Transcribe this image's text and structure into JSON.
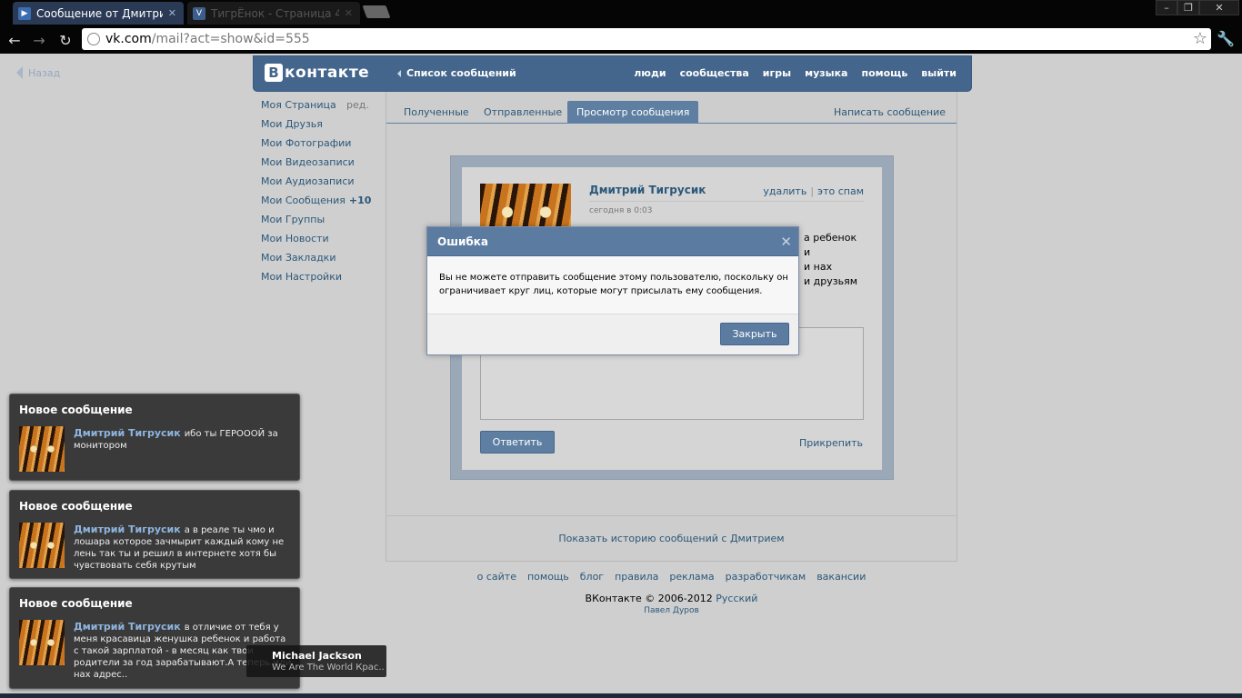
{
  "browser": {
    "tabs": [
      {
        "title": "Сообщение от Дмитрия Тг",
        "favicon": "play-icon",
        "active": true
      },
      {
        "title": "ТигрЁнок - Страница 4",
        "favicon": "vk-icon",
        "active": false
      }
    ],
    "url_domain": "vk.com",
    "url_path": "/mail?act=show&id=555"
  },
  "page": {
    "back_label": "Назад",
    "header": {
      "logo_letter": "B",
      "logo_text": "контакте",
      "messages_list": "Список сообщений",
      "nav": [
        "люди",
        "сообщества",
        "игры",
        "музыка",
        "помощь",
        "выйти"
      ]
    },
    "left_menu": {
      "edit_label": "ред.",
      "items": [
        {
          "label": "Моя Страница"
        },
        {
          "label": "Мои Друзья"
        },
        {
          "label": "Мои Фотографии"
        },
        {
          "label": "Мои Видеозаписи"
        },
        {
          "label": "Мои Аудиозаписи"
        },
        {
          "label": "Мои Сообщения",
          "count": "+10"
        },
        {
          "label": "Мои Группы"
        },
        {
          "label": "Мои Новости"
        },
        {
          "label": "Мои Закладки"
        },
        {
          "label": "Мои Настройки"
        }
      ]
    },
    "tabs": [
      "Полученные",
      "Отправленные",
      "Просмотр сообщения"
    ],
    "write_message": "Написать сообщение",
    "message": {
      "author": "Дмитрий Тигрусик",
      "delete": "удалить",
      "spam": "это спам",
      "time": "сегодня в 0:03",
      "text_lines": [
        "а ребенок",
        "и",
        "и нах",
        "и друзьям"
      ],
      "reply_button": "Ответить",
      "attach": "Прикрепить"
    },
    "history_link": "Показать историю сообщений с Дмитрием",
    "footer_links": [
      "о сайте",
      "помощь",
      "блог",
      "правила",
      "реклама",
      "разработчикам",
      "вакансии"
    ],
    "copyright": "ВКонтакте © 2006-2012",
    "language": "Русский",
    "author": "Павел Дуров"
  },
  "dialog": {
    "title": "Ошибка",
    "body": "Вы не можете отправить сообщение этому пользователю, поскольку он ограничивает круг лиц, которые могут присылать ему сообщения.",
    "close_button": "Закрыть"
  },
  "notifications": [
    {
      "title": "Новое сообщение",
      "author": "Дмитрий Тигрусик",
      "text": "ибо ты ГЕРОООЙ за монитором"
    },
    {
      "title": "Новое сообщение",
      "author": "Дмитрий Тигрусик",
      "text": "а в реале ты чмо и лошара которое зачмырит каждый кому не лень так ты и решил в интернете хотя бы чувствовать себя крутым"
    },
    {
      "title": "Новое сообщение",
      "author": "Дмитрий Тигрусик",
      "text": "в отличие от тебя у меня красавица женушка ребенок и работа с такой зарплатой - в месяц как твои родители за год зарабатывают.А теперь иди нах адрес.."
    }
  ],
  "tooltip": {
    "artist": "Michael Jackson",
    "track": "We Are The World Крас..."
  },
  "colors": {
    "vk_blue": "#44658c",
    "link": "#2b587a",
    "dialog_head": "#5b7ba1"
  }
}
